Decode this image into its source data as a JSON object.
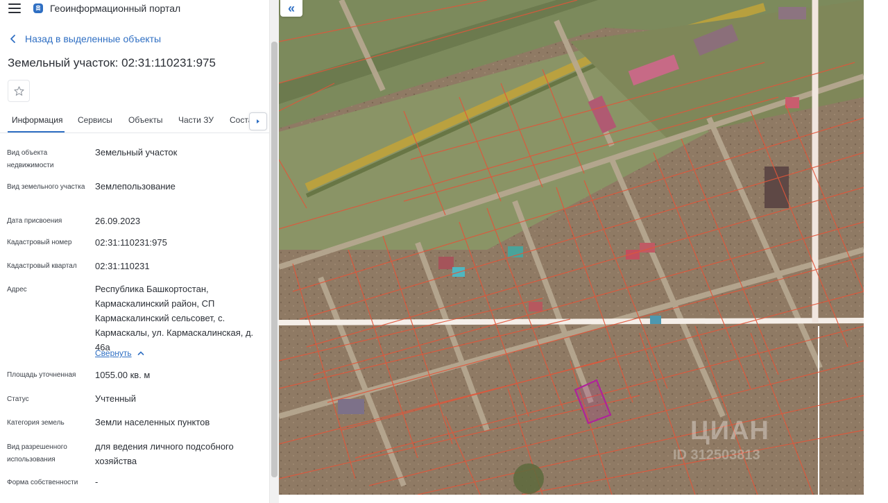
{
  "app": {
    "title": "Геоинформационный портал"
  },
  "nav": {
    "back_label": "Назад в выделенные объекты"
  },
  "object": {
    "title": "Земельный участок: 02:31:110231:975"
  },
  "tabs": [
    {
      "label": "Информация",
      "active": true
    },
    {
      "label": "Сервисы"
    },
    {
      "label": "Объекты"
    },
    {
      "label": "Части ЗУ"
    },
    {
      "label": "Соста"
    }
  ],
  "details": [
    {
      "key": "Вид объекта недвижимости",
      "value": "Земельный участок"
    },
    {
      "key": "Вид земельного участка",
      "value": "Землепользование"
    },
    {
      "key": "Дата присвоения",
      "value": "26.09.2023"
    },
    {
      "key": "Кадастровый номер",
      "value": "02:31:110231:975"
    },
    {
      "key": "Кадастровый квартал",
      "value": "02:31:110231"
    },
    {
      "key": "Адрес",
      "value": "Республика Башкортостан, Кармаскалинский район, СП Кармаскалинский сельсовет, с. Кармаскалы, ул. Кармаскалинская, д. 46а"
    },
    {
      "key": "Площадь уточненная",
      "value": "1055.00 кв. м"
    },
    {
      "key": "Статус",
      "value": "Учтенный"
    },
    {
      "key": "Категория земель",
      "value": "Земли населенных пунктов"
    },
    {
      "key": "Вид разрешенного использования",
      "value": "для ведения личного подсобного хозяйства"
    },
    {
      "key": "Форма собственности",
      "value": "-"
    }
  ],
  "address_toggle": {
    "label": "Свернуть"
  },
  "map": {
    "collapse_icon": "«",
    "watermark": "ЦИАН",
    "watermark_id": "ID 312503813"
  },
  "colors": {
    "accent": "#2f6fc3",
    "parcel_line": "#e0563a",
    "selected_parcel": "#b0229a"
  },
  "icons": [
    "menu-icon",
    "logo-icon",
    "chevron-left-icon",
    "star-icon",
    "chevron-right-icon",
    "chevron-up-icon",
    "double-chevron-left-icon"
  ]
}
